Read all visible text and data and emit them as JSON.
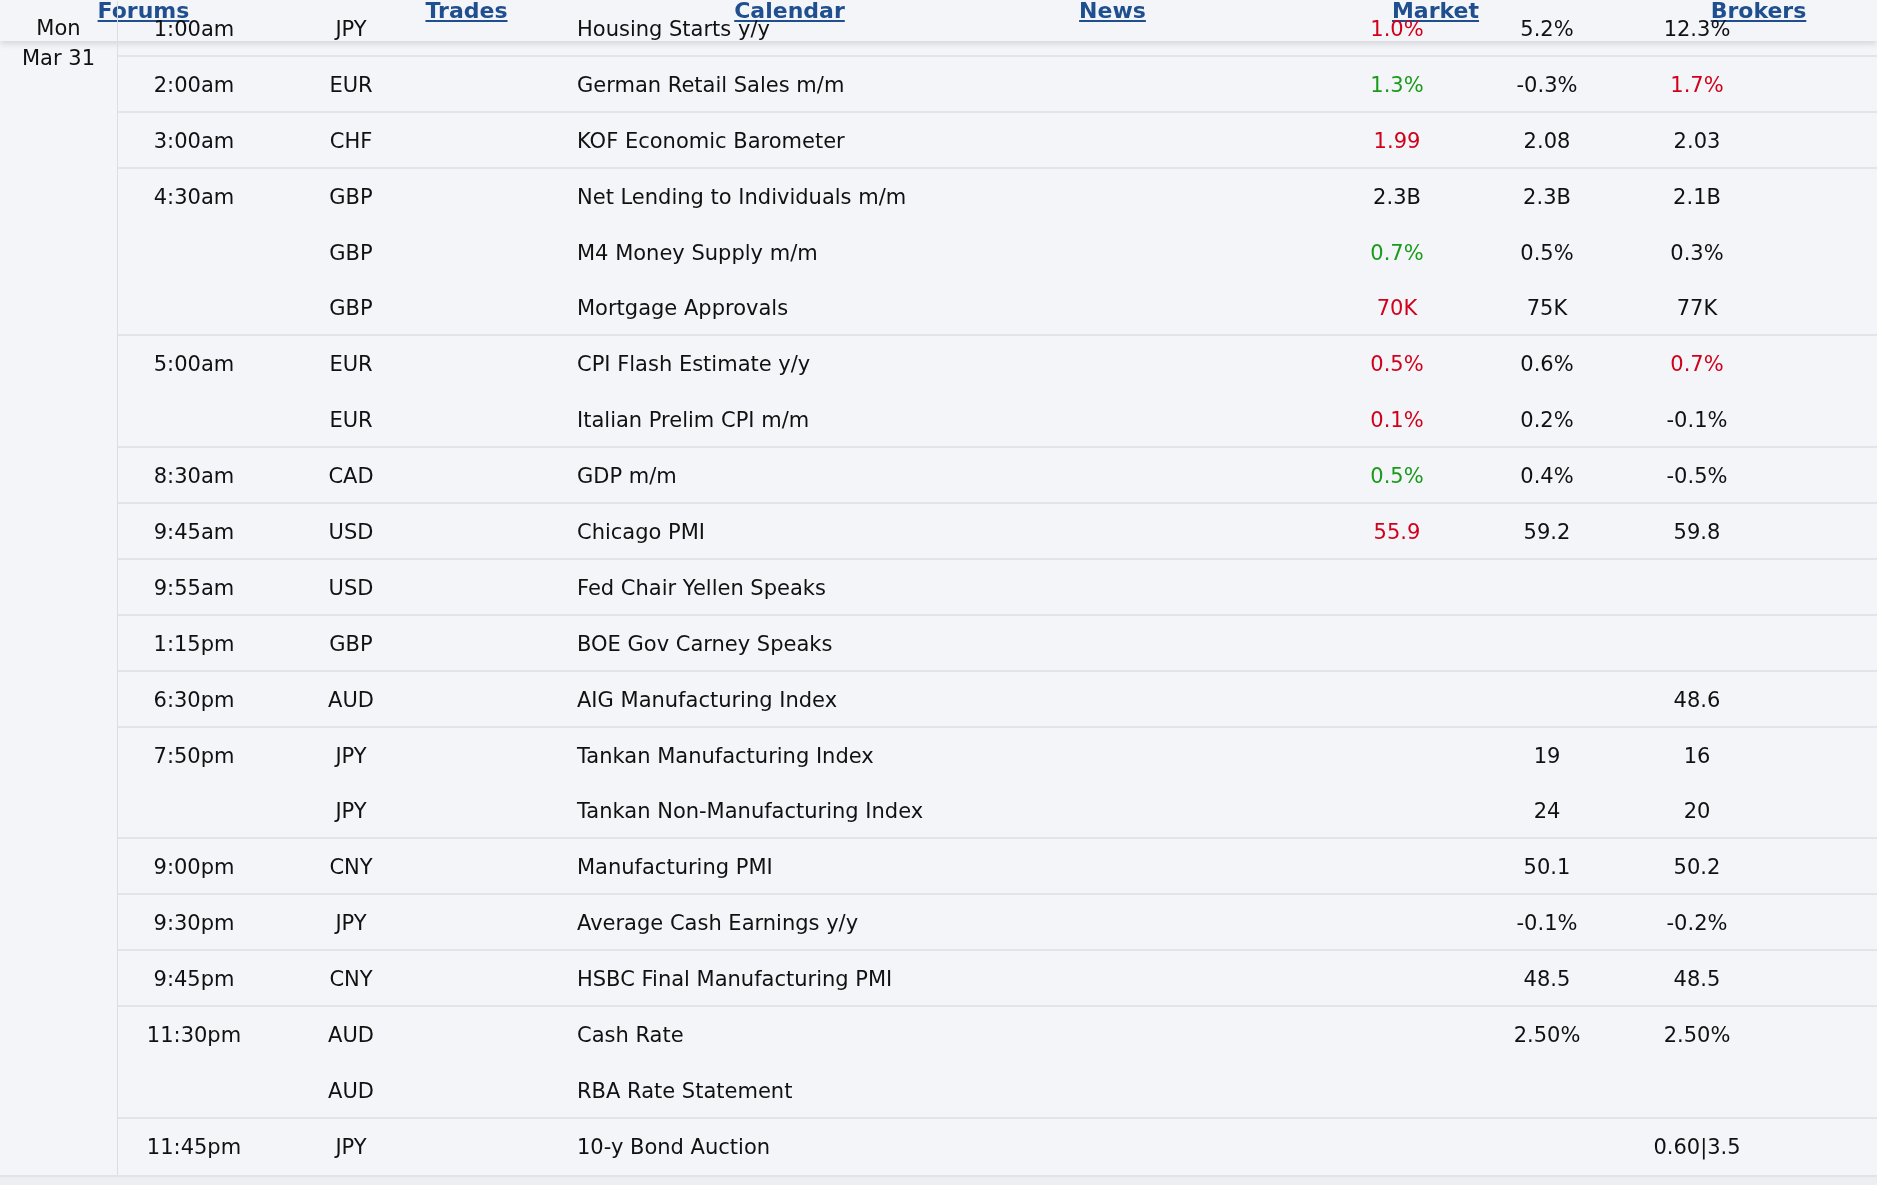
{
  "nav": {
    "links": [
      {
        "label": "Forums"
      },
      {
        "label": "Trades"
      },
      {
        "label": "Calendar"
      },
      {
        "label": "News"
      },
      {
        "label": "Market"
      },
      {
        "label": "Brokers"
      }
    ]
  },
  "day": {
    "weekday": "Mon",
    "date": "Mar 31"
  },
  "groups": [
    {
      "time": "1:00am",
      "events": [
        {
          "currency": "JPY",
          "event": "Housing Starts y/y",
          "actual": {
            "text": "1.0%",
            "color": "#d0021b"
          },
          "forecast": "5.2%",
          "previous": {
            "text": "12.3%"
          }
        }
      ]
    },
    {
      "time": "2:00am",
      "events": [
        {
          "currency": "EUR",
          "event": "German Retail Sales m/m",
          "actual": {
            "text": "1.3%",
            "color": "#1c9a1c"
          },
          "forecast": "-0.3%",
          "previous": {
            "text": "1.7%",
            "color": "#d0021b"
          }
        }
      ]
    },
    {
      "time": "3:00am",
      "events": [
        {
          "currency": "CHF",
          "event": "KOF Economic Barometer",
          "actual": {
            "text": "1.99",
            "color": "#d0021b"
          },
          "forecast": "2.08",
          "previous": {
            "text": "2.03"
          }
        }
      ]
    },
    {
      "time": "4:30am",
      "events": [
        {
          "currency": "GBP",
          "event": "Net Lending to Individuals m/m",
          "actual": {
            "text": "2.3B"
          },
          "forecast": "2.3B",
          "previous": {
            "text": "2.1B"
          }
        },
        {
          "currency": "GBP",
          "event": "M4 Money Supply m/m",
          "actual": {
            "text": "0.7%",
            "color": "#1c9a1c"
          },
          "forecast": "0.5%",
          "previous": {
            "text": "0.3%"
          }
        },
        {
          "currency": "GBP",
          "event": "Mortgage Approvals",
          "actual": {
            "text": "70K",
            "color": "#d0021b"
          },
          "forecast": "75K",
          "previous": {
            "text": "77K"
          }
        }
      ]
    },
    {
      "time": "5:00am",
      "events": [
        {
          "currency": "EUR",
          "event": "CPI Flash Estimate y/y",
          "actual": {
            "text": "0.5%",
            "color": "#d0021b"
          },
          "forecast": "0.6%",
          "previous": {
            "text": "0.7%",
            "color": "#d0021b"
          }
        },
        {
          "currency": "EUR",
          "event": "Italian Prelim CPI m/m",
          "actual": {
            "text": "0.1%",
            "color": "#d0021b"
          },
          "forecast": "0.2%",
          "previous": {
            "text": "-0.1%"
          }
        }
      ]
    },
    {
      "time": "8:30am",
      "events": [
        {
          "currency": "CAD",
          "event": "GDP m/m",
          "actual": {
            "text": "0.5%",
            "color": "#1c9a1c"
          },
          "forecast": "0.4%",
          "previous": {
            "text": "-0.5%"
          }
        }
      ]
    },
    {
      "time": "9:45am",
      "events": [
        {
          "currency": "USD",
          "event": "Chicago PMI",
          "actual": {
            "text": "55.9",
            "color": "#d0021b"
          },
          "forecast": "59.2",
          "previous": {
            "text": "59.8"
          }
        }
      ]
    },
    {
      "time": "9:55am",
      "events": [
        {
          "currency": "USD",
          "event": "Fed Chair Yellen Speaks"
        }
      ]
    },
    {
      "time": "1:15pm",
      "events": [
        {
          "currency": "GBP",
          "event": "BOE Gov Carney Speaks"
        }
      ]
    },
    {
      "time": "6:30pm",
      "events": [
        {
          "currency": "AUD",
          "event": "AIG Manufacturing Index",
          "previous": {
            "text": "48.6"
          }
        }
      ]
    },
    {
      "time": "7:50pm",
      "events": [
        {
          "currency": "JPY",
          "event": "Tankan Manufacturing Index",
          "forecast": "19",
          "previous": {
            "text": "16"
          }
        },
        {
          "currency": "JPY",
          "event": "Tankan Non-Manufacturing Index",
          "forecast": "24",
          "previous": {
            "text": "20"
          }
        }
      ]
    },
    {
      "time": "9:00pm",
      "events": [
        {
          "currency": "CNY",
          "event": "Manufacturing PMI",
          "forecast": "50.1",
          "previous": {
            "text": "50.2"
          }
        }
      ]
    },
    {
      "time": "9:30pm",
      "events": [
        {
          "currency": "JPY",
          "event": "Average Cash Earnings y/y",
          "forecast": "-0.1%",
          "previous": {
            "text": "-0.2%"
          }
        }
      ]
    },
    {
      "time": "9:45pm",
      "events": [
        {
          "currency": "CNY",
          "event": "HSBC Final Manufacturing PMI",
          "forecast": "48.5",
          "previous": {
            "text": "48.5"
          }
        }
      ]
    },
    {
      "time": "11:30pm",
      "events": [
        {
          "currency": "AUD",
          "event": "Cash Rate",
          "forecast": "2.50%",
          "previous": {
            "text": "2.50%"
          }
        },
        {
          "currency": "AUD",
          "event": "RBA Rate Statement"
        }
      ]
    },
    {
      "time": "11:45pm",
      "events": [
        {
          "currency": "JPY",
          "event": "10-y Bond Auction",
          "previous": {
            "text": "0.60|3.5"
          }
        }
      ]
    }
  ]
}
